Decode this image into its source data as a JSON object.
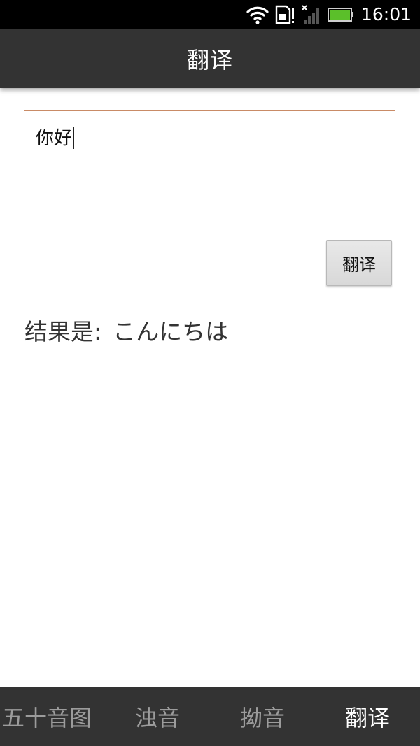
{
  "status_bar": {
    "time": "16:01",
    "icons": [
      "wifi-icon",
      "sim-card-alert-icon",
      "no-signal-icon",
      "battery-icon"
    ],
    "battery_color": "#5bbf2a"
  },
  "title_bar": {
    "title": "翻译"
  },
  "translate_form": {
    "input_value": "你好",
    "button_label": "翻译",
    "input_border_color": "#c98b66"
  },
  "result": {
    "label": "结果是:",
    "value": "こんにちは"
  },
  "tab_bar": {
    "tabs": [
      {
        "label": "五十音图",
        "active": false
      },
      {
        "label": "浊音",
        "active": false
      },
      {
        "label": "拗音",
        "active": false
      },
      {
        "label": "翻译",
        "active": true
      }
    ],
    "active_color": "#ffffff",
    "inactive_color": "#9c9c9c"
  }
}
